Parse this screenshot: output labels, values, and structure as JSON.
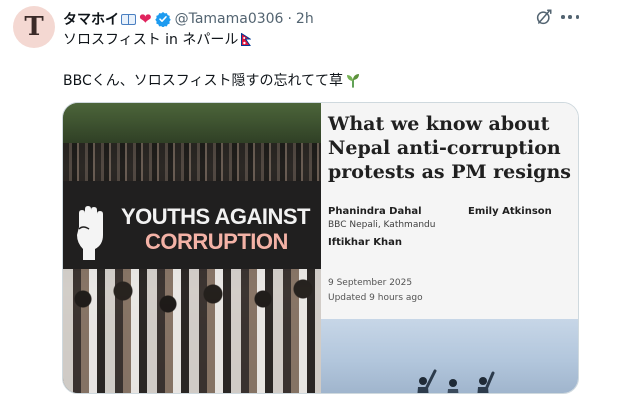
{
  "avatar": {
    "letter": "T"
  },
  "header": {
    "display_name": "タマホイ",
    "book_emoji": "book",
    "heart_emoji": "❤",
    "handle": "@Tamama0306",
    "separator": "·",
    "time": "2h"
  },
  "profile_subtitle": "ソロスフィスト in ネパール",
  "tweet_text": "BBCくん、ソロスフィスト隠すの忘れてて草",
  "card": {
    "banner": {
      "line1": "YOUTHS AGAINST",
      "line2": "CORRUPTION"
    },
    "headline": "What we know about Nepal anti-corruption protests as PM resigns",
    "authors": [
      {
        "name": "Phanindra Dahal",
        "org": "BBC Nepali, Kathmandu"
      },
      {
        "name": "Emily Atkinson"
      },
      {
        "name": "Iftikhar Khan"
      }
    ],
    "date": "9 September 2025",
    "updated": "Updated 9 hours ago"
  },
  "icons": {
    "verified": "verified-badge-icon",
    "flag": "nepal-flag-icon",
    "sprout": "seedling-icon",
    "grok": "grok-icon",
    "more": "more-options-icon",
    "fist": "raised-fist-icon"
  },
  "colors": {
    "text": "#0f1419",
    "secondary": "#536471",
    "verified_blue": "#1d9bf0",
    "heart": "#e0245e",
    "card_border": "#cfd9de",
    "banner_red_text": "#f4b2a6"
  }
}
